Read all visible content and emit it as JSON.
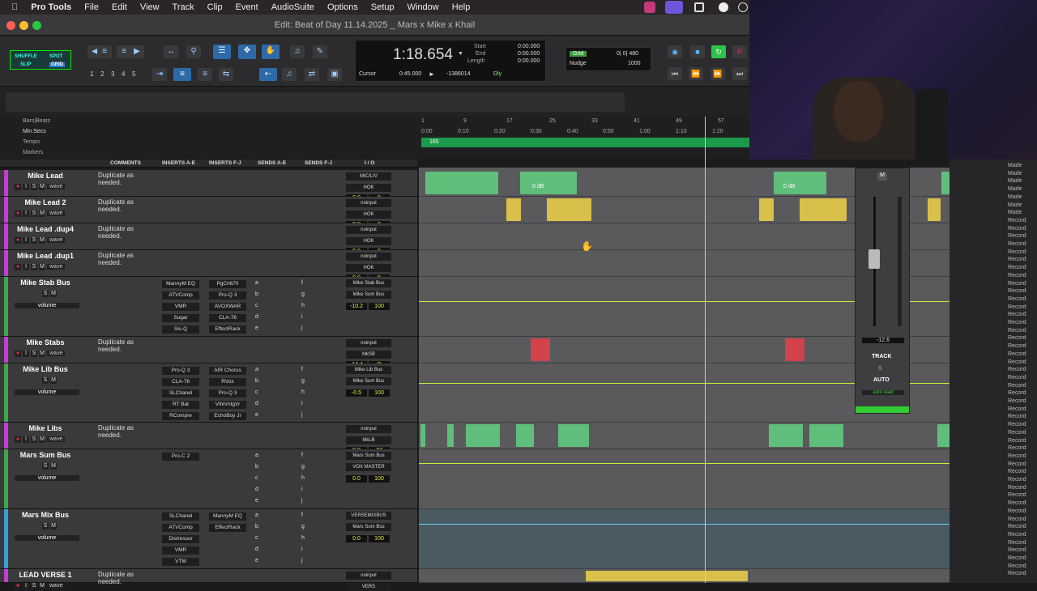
{
  "menubar": {
    "app": "Pro Tools",
    "items": [
      "File",
      "Edit",
      "View",
      "Track",
      "Clip",
      "Event",
      "AudioSuite",
      "Options",
      "Setup",
      "Window",
      "Help"
    ]
  },
  "window": {
    "title": "Edit: Beat of Day 11.14.2025 _ Mars x Mike x Khail"
  },
  "modes": {
    "shuffle": "SHUFFLE",
    "spot": "SPOT",
    "slip": "SLIP",
    "grid": "GRID"
  },
  "zoom_presets": [
    "1",
    "2",
    "3",
    "4",
    "5"
  ],
  "counter": {
    "main": "1:18.654",
    "start_label": "Start",
    "end_label": "End",
    "length_label": "Length",
    "start": "0:00.000",
    "end": "0:00.000",
    "length": "0:00.000",
    "cursor_label": "Cursor",
    "cursor_val": "0:45.000",
    "sample": "-1386014",
    "dly": "Dly"
  },
  "grid": {
    "label": "Grid",
    "value": "0| 0| 480",
    "nudge_label": "Nudge",
    "nudge_value": "1000"
  },
  "rulers": {
    "bars": "Bars|Beats",
    "minsecs": "Min:Secs",
    "tempo": "Tempo",
    "markers": "Markers",
    "tempo_val": "165",
    "bar_ticks": [
      "1",
      "9",
      "17",
      "25",
      "33",
      "41",
      "49",
      "57"
    ],
    "time_ticks": [
      "0:00",
      "0:10",
      "0:20",
      "0:30",
      "0:40",
      "0:50",
      "1:00",
      "1:10",
      "1:20"
    ]
  },
  "columns": {
    "comments": "COMMENTS",
    "inserts_ae": "INSERTS A-E",
    "inserts_fj": "INSERTS F-J",
    "sends_ae": "SENDS A-E",
    "sends_fj": "SENDS F-J",
    "io": "I / O"
  },
  "tracks": [
    {
      "name": "Mike Lead",
      "comment": "Duplicate as needed.",
      "in": "MIC/LIV",
      "out": "HOK",
      "vol": "0.0",
      "pan": "0",
      "view": "wave",
      "color": "#c43dd6"
    },
    {
      "name": "Mike Lead 2",
      "comment": "Duplicate as needed.",
      "in": "noinput",
      "out": "HOK",
      "vol": "0.0",
      "pan": "0",
      "view": "wave",
      "color": "#c43dd6"
    },
    {
      "name": "Mike Lead .dup4",
      "comment": "Duplicate as needed.",
      "in": "noinput",
      "out": "HOK",
      "vol": "0.0",
      "pan": "0",
      "view": "wave",
      "color": "#c43dd6"
    },
    {
      "name": "Mike Lead .dup1",
      "comment": "Duplicate as needed.",
      "in": "noinput",
      "out": "HOK",
      "vol": "0.0",
      "pan": "0",
      "view": "wave",
      "color": "#c43dd6"
    },
    {
      "name": "Mike Stab Bus",
      "comment": "",
      "inserts_a": [
        "MannyM EQ",
        "ATVComp",
        "VMR",
        "Sugar",
        "Sis-Q"
      ],
      "inserts_f": [
        "PgCh670",
        "Pro-Q 3",
        "AVOXWAR",
        "CLA-76",
        "EffectRack"
      ],
      "in": "Mike Stab Bus",
      "out": "Mike Sum Bus",
      "vol": "-10.2",
      "pan": "100",
      "view": "volume",
      "color": "#3fa64a"
    },
    {
      "name": "Mike Stabs",
      "comment": "Duplicate as needed.",
      "in": "noinput",
      "out": "MkSB",
      "vol": "-14.4",
      "pan": "P",
      "view": "wave",
      "color": "#c43dd6"
    },
    {
      "name": "Mike Lib Bus",
      "comment": "",
      "inserts_a": [
        "Pro-Q 3",
        "CLA-76",
        "SLChanel",
        "RT Bat",
        "RCompre"
      ],
      "inserts_f": [
        "AIR Chorus",
        "RVox",
        "Pro-Q 3",
        "VlhlVntgVr",
        "EchoBoy Jr"
      ],
      "in": "Mike Lib Bus",
      "out": "Mike Sum Bus",
      "vol": "-0.5",
      "pan": "100",
      "view": "volume",
      "color": "#3fa64a"
    },
    {
      "name": "Mike Libs",
      "comment": "Duplicate as needed.",
      "in": "noinput",
      "out": "MkLB",
      "vol": "0.0",
      "pan": "27",
      "view": "wave",
      "color": "#c43dd6"
    },
    {
      "name": "Mars Sum Bus",
      "comment": "",
      "inserts_a": [
        "Pro-C 2"
      ],
      "inserts_f": [],
      "in": "Mars Sum Bus",
      "out": "VOX MASTER",
      "vol": "0.0",
      "pan": "100",
      "view": "volume",
      "color": "#3fa64a"
    },
    {
      "name": "Mars Mix Bus",
      "comment": "",
      "inserts_a": [
        "SLChanel",
        "ATVComp",
        "Distressor",
        "VMR",
        "VTM"
      ],
      "inserts_f": [
        "MannyM EQ",
        "EffectRack"
      ],
      "in": "VERSEMIXBUS",
      "out": "Mars Sum Bus",
      "vol": "0.0",
      "pan": "100",
      "view": "volume",
      "color": "#3aa0d0"
    },
    {
      "name": "LEAD VERSE 1",
      "comment": "Duplicate as needed.",
      "in": "noinput",
      "out": "VERS",
      "vol": "",
      "pan": "",
      "view": "wave",
      "color": "#c43dd6"
    }
  ],
  "send_letters": [
    "a",
    "b",
    "c",
    "d",
    "e"
  ],
  "send_letters2": [
    "f",
    "g",
    "h",
    "i",
    "j"
  ],
  "mixer": {
    "track_label": "TRACK",
    "auto_label": "AUTO",
    "auto_mode": "auto read",
    "value": "-12.6",
    "mute": "M",
    "solo": "S"
  },
  "clip_labels": {
    "db": "0 dB"
  },
  "browser": [
    "Made",
    "Made",
    "Made",
    "Made",
    "Made",
    "Made",
    "Made",
    "Record",
    "Record",
    "Record",
    "Record",
    "Record",
    "Record",
    "Record",
    "Record",
    "Record",
    "Record",
    "Record",
    "Record",
    "Record",
    "Record",
    "Record",
    "Record",
    "Record",
    "Record",
    "Record",
    "Record",
    "Record",
    "Record",
    "Record",
    "Record",
    "Record",
    "Record",
    "Record",
    "Record",
    "Record",
    "Record",
    "Record",
    "Record",
    "Record",
    "Record",
    "Record",
    "Record",
    "Record",
    "Record",
    "Record",
    "Record",
    "Record",
    "Record",
    "Record",
    "Record",
    "Record",
    "Record"
  ]
}
